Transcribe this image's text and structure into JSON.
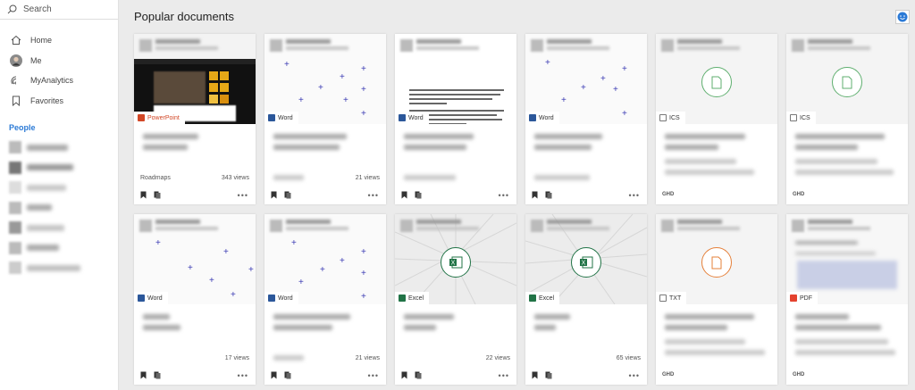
{
  "search": {
    "label": "Search"
  },
  "nav": [
    {
      "label": "Home",
      "icon": "home-icon"
    },
    {
      "label": "Me",
      "icon": "avatar"
    },
    {
      "label": "MyAnalytics",
      "icon": "analytics-icon"
    },
    {
      "label": "Favorites",
      "icon": "bookmark-icon"
    }
  ],
  "people_title": "People",
  "main": {
    "title": "Popular documents"
  },
  "colors": {
    "accent": "#2b7ad6",
    "word": "#2b579a",
    "excel": "#217346",
    "powerpoint": "#d24726",
    "pdf": "#e4422e",
    "ics": "#5faf6f",
    "txt": "#e5803a"
  },
  "cards": [
    {
      "type": "PowerPoint",
      "meta_left": "Roadmaps",
      "views": "343 views"
    },
    {
      "type": "Word",
      "meta_left": "",
      "views": "21 views"
    },
    {
      "type": "Word",
      "meta_left": "",
      "views": ""
    },
    {
      "type": "Word",
      "meta_left": "",
      "views": ""
    },
    {
      "type": "ICS",
      "meta_left": "",
      "views": "",
      "footer": "GHD"
    },
    {
      "type": "ICS",
      "meta_left": "",
      "views": "",
      "footer": "GHD"
    },
    {
      "type": "Word",
      "meta_left": "",
      "views": "17 views"
    },
    {
      "type": "Word",
      "meta_left": "",
      "views": "21 views"
    },
    {
      "type": "Excel",
      "meta_left": "",
      "views": "22 views"
    },
    {
      "type": "Excel",
      "meta_left": "",
      "views": "65 views"
    },
    {
      "type": "TXT",
      "meta_left": "",
      "views": "",
      "footer": "GHD"
    },
    {
      "type": "PDF",
      "meta_left": "",
      "views": "",
      "footer": "GHD"
    }
  ]
}
